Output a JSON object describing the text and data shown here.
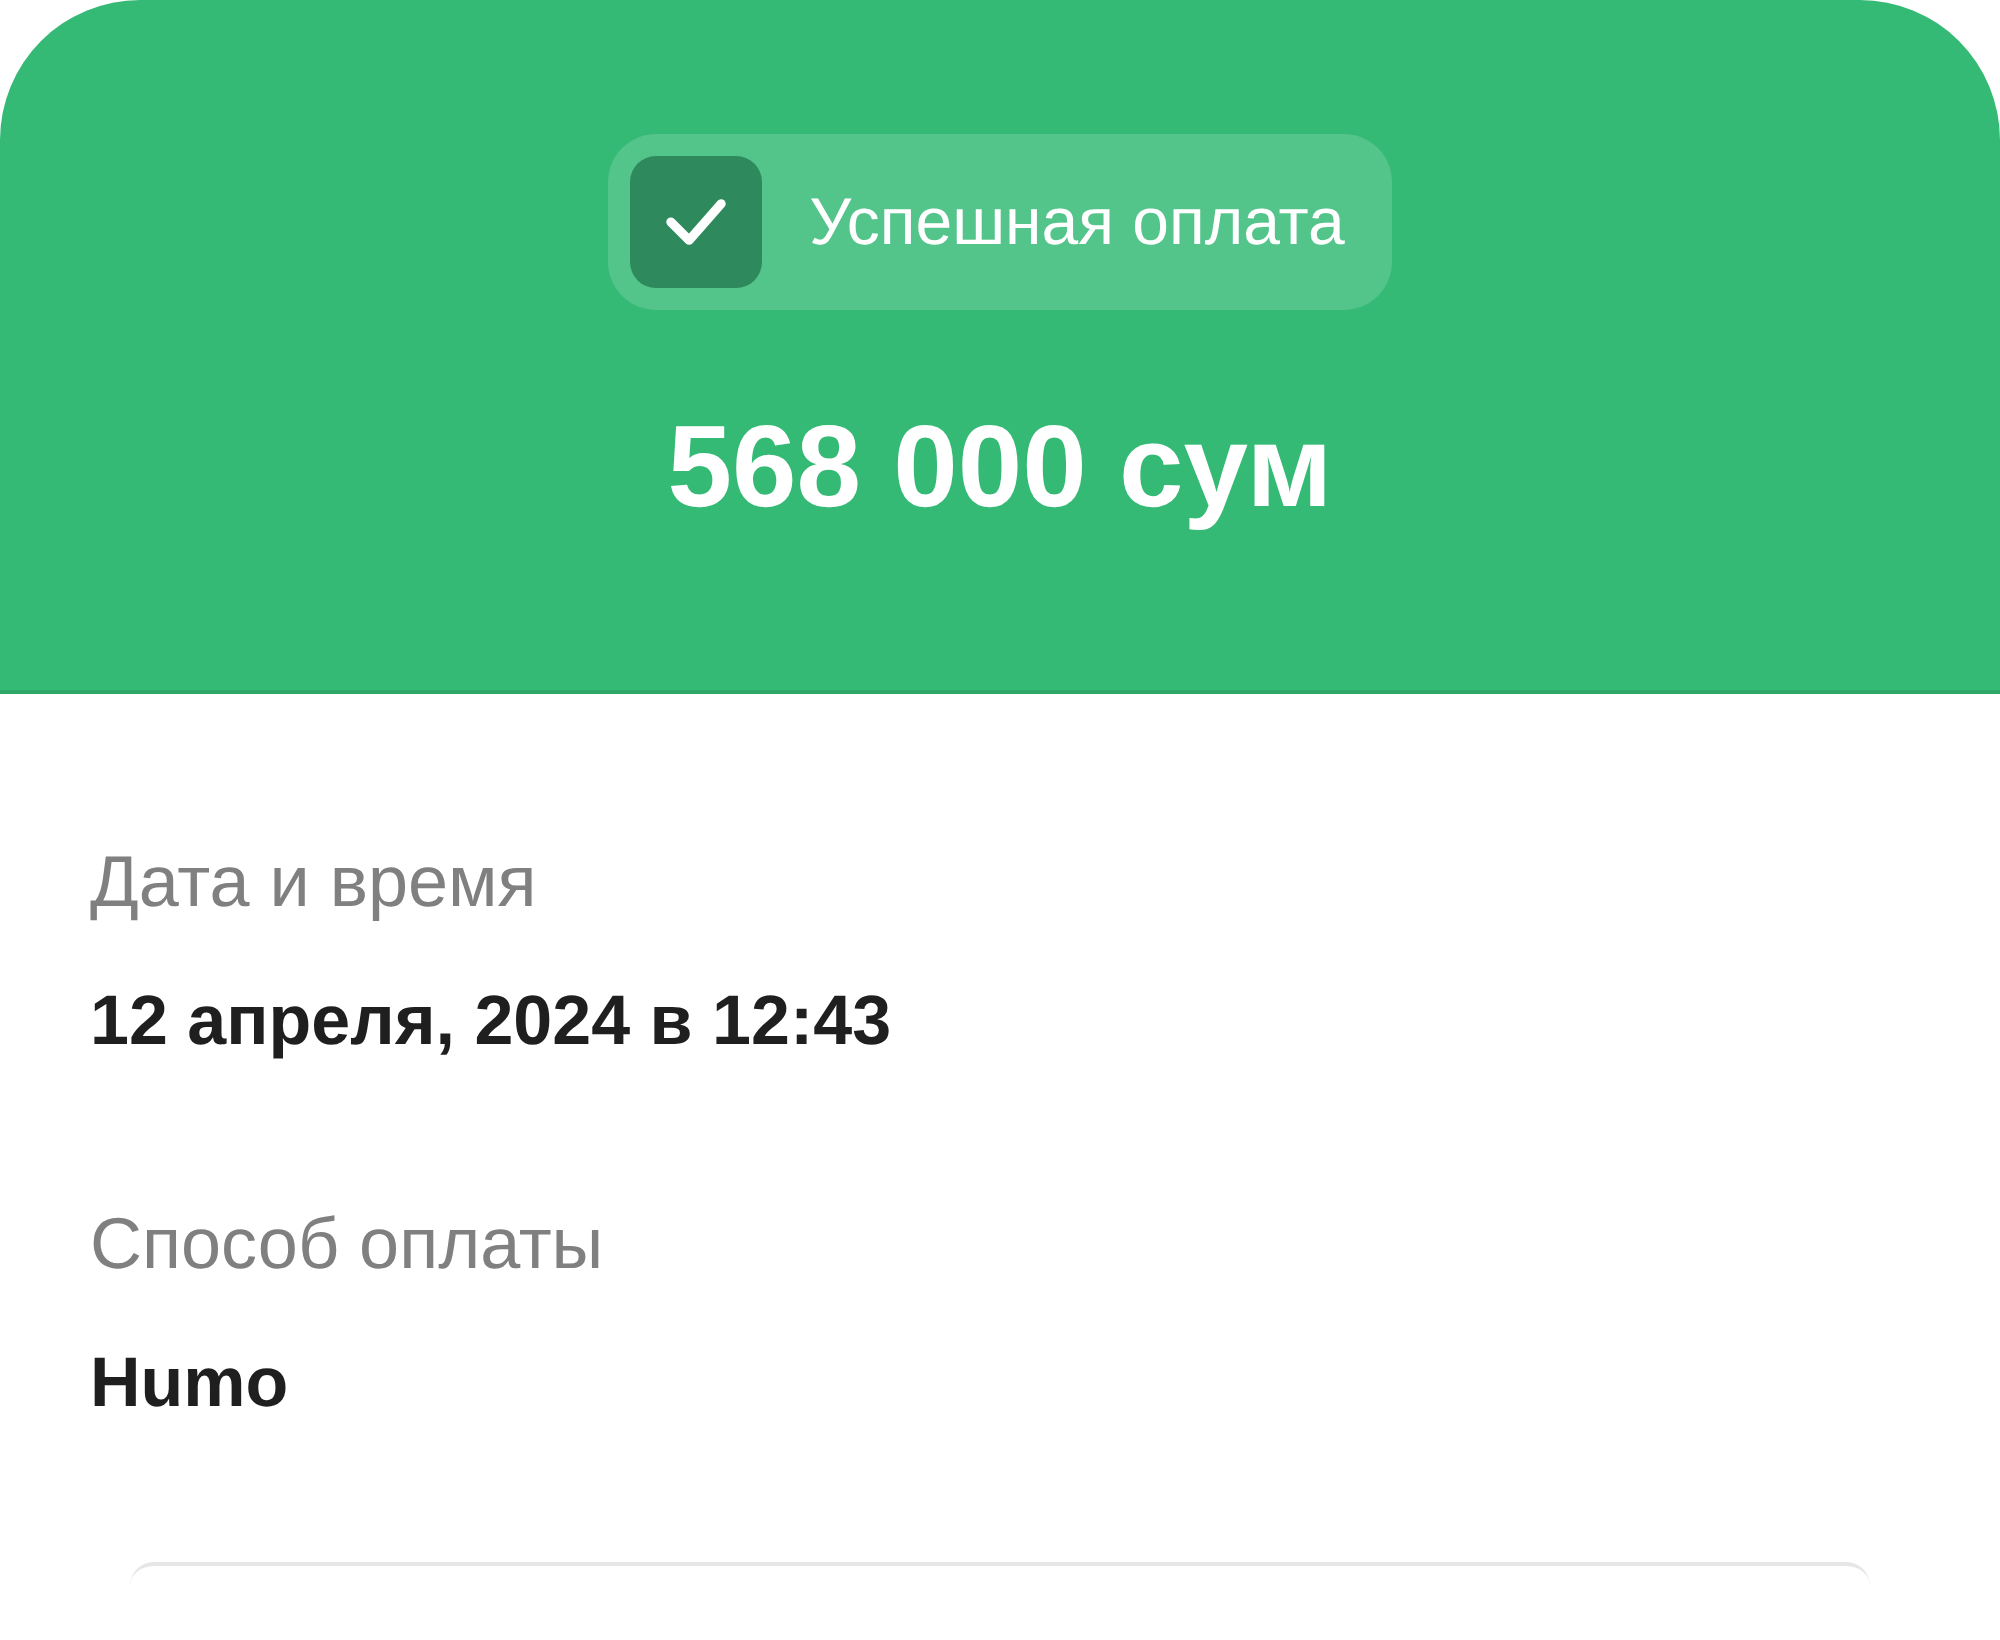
{
  "header": {
    "status": {
      "kind": "success",
      "label": "Успешная оплата"
    },
    "amount": "568 000 сум"
  },
  "details": [
    {
      "label": "Дата и время",
      "value": "12 апреля, 2024 в 12:43"
    },
    {
      "label": "Способ оплаты",
      "value": "Humo"
    }
  ]
}
